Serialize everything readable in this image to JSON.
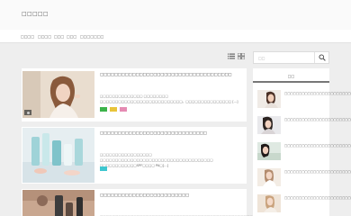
{
  "header": {
    "logo": "□□□□□"
  },
  "nav": {
    "items": [
      {
        "label": "□□□□"
      },
      {
        "label": "□□□□"
      },
      {
        "label": "□□□"
      },
      {
        "label": "□□□"
      },
      {
        "label": "□□□□□□□"
      }
    ]
  },
  "view_toggle": {
    "list_icon": "list-view-icon",
    "grid_icon": "grid-view-icon"
  },
  "search": {
    "placeholder": "□□",
    "icon": "search-icon"
  },
  "posts": [
    {
      "title": "□□□□□□□□□□□□□□□□□□□□□□□□□□□□□□□□□□□□□",
      "excerpt": "□□□□□□□□□□□□□□ □□□□□□□□ □□□□□□□□□□□□□□□□□□□□□□□□□□□。□□□□□□□□□□□□□□□ [...]",
      "tags": [
        {
          "color": "#3cb34a"
        },
        {
          "color": "#e8c43a"
        },
        {
          "color": "#e58bb3"
        }
      ]
    },
    {
      "title": "□□□□□□□□□□□□□□□□□□□□□□□□□□□□□□",
      "excerpt": "□□□□□□□□□□□□□□□□□ □□□□□□□□□□□□□□□□□□□□□□□□□□□□□□□□□□□□□ □□□□□□□□□□□□SPF□□□□ PA□[...]",
      "tags": [
        {
          "color": "#3ec6cf"
        }
      ]
    },
    {
      "title": "□□□□□□□□□□□□□□□□□□□□□□□□□",
      "excerpt": "□□□□□□□□□□□□□□□□□□□□□□□□□□□□□□□□□□□□□□□□□□□□□□□□□□□□",
      "tags": []
    }
  ],
  "sidebar": {
    "heading": "□□",
    "items": [
      {
        "title": "□□□□□□□□□□□□□□□□□□□□□□□□□□"
      },
      {
        "title": "□□□□□□□□□□□□□□□□□□□□□□□□□□"
      },
      {
        "title": "□□□□□□□□□□□□□□□□□□□□□□□□□□"
      },
      {
        "title": "□□□□□□□□□□□□□□□□□□□□□□□□□□"
      },
      {
        "title": "□□□□□□□□□□□□□□□□□□□□□□□□□□"
      }
    ]
  }
}
